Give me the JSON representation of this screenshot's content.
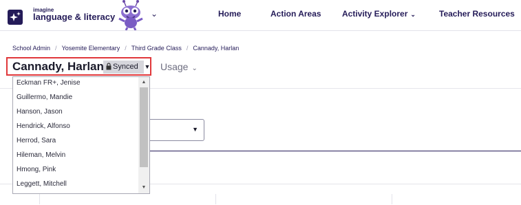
{
  "brand": {
    "line1": "imagine",
    "line2": "language & literacy"
  },
  "nav": {
    "home": "Home",
    "action_areas": "Action Areas",
    "activity_explorer": "Activity Explorer",
    "teacher_resources": "Teacher Resources"
  },
  "breadcrumb": [
    "School Admin",
    "Yosemite Elementary",
    "Third Grade Class",
    "Cannady, Harlan"
  ],
  "student_selector": {
    "selected": "Cannady, Harlan",
    "badge": "Synced"
  },
  "usage_tab": "Usage",
  "students": [
    "Eckman FR+, Jenise",
    "Guillermo, Mandie",
    "Hanson, Jason",
    "Hendrick, Alfonso",
    "Herrod, Sara",
    "Hileman, Melvin",
    "Hmong, Pink",
    "Leggett, Mitchell"
  ],
  "colors": {
    "brand_navy": "#241b58",
    "highlight_red": "#e0373a",
    "badge_gray": "#d6d6dc"
  }
}
